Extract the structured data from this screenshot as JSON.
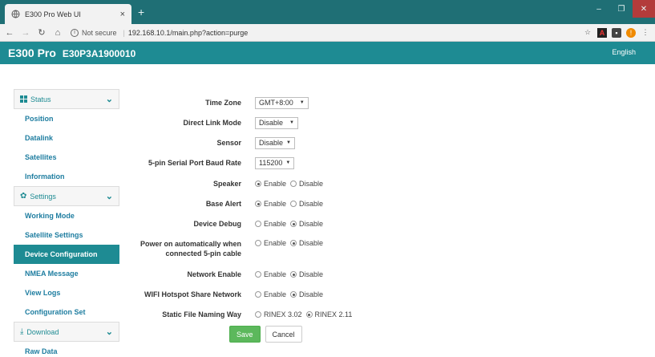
{
  "browser": {
    "tab_title": "E300 Pro Web UI",
    "tab_close": "×",
    "new_tab": "+",
    "not_secure": "Not secure",
    "url": "192.168.10.1/main.php?action=purge",
    "window_controls": [
      "–",
      "❐",
      "✕"
    ]
  },
  "header": {
    "brand": "E300 Pro",
    "serial": "E30P3A1900010",
    "language": "English"
  },
  "sidebar": {
    "status": {
      "label": "Status",
      "items": [
        "Position",
        "Datalink",
        "Satellites",
        "Information"
      ]
    },
    "settings": {
      "label": "Settings",
      "items": [
        "Working Mode",
        "Satellite Settings",
        "Device Configuration",
        "NMEA Message",
        "View Logs",
        "Configuration Set"
      ],
      "active": "Device Configuration"
    },
    "download": {
      "label": "Download",
      "items": [
        "Raw Data"
      ]
    }
  },
  "form": {
    "time_zone": {
      "label": "Time Zone",
      "value": "GMT+8:00"
    },
    "direct_link_mode": {
      "label": "Direct Link Mode",
      "value": "Disable"
    },
    "sensor": {
      "label": "Sensor",
      "value": "Disable"
    },
    "baud_rate": {
      "label": "5-pin Serial Port Baud Rate",
      "value": "115200"
    },
    "speaker": {
      "label": "Speaker",
      "opt1": "Enable",
      "opt2": "Disable",
      "selected": "Enable"
    },
    "base_alert": {
      "label": "Base Alert",
      "opt1": "Enable",
      "opt2": "Disable",
      "selected": "Enable"
    },
    "device_debug": {
      "label": "Device Debug",
      "opt1": "Enable",
      "opt2": "Disable",
      "selected": "Disable"
    },
    "power_on": {
      "label_line1": "Power on automatically when",
      "label_line2": "connected 5-pin cable",
      "opt1": "Enable",
      "opt2": "Disable",
      "selected": "Disable"
    },
    "network_enable": {
      "label": "Network Enable",
      "opt1": "Enable",
      "opt2": "Disable",
      "selected": "Disable"
    },
    "wifi_hotspot": {
      "label": "WIFI Hotspot Share Network",
      "opt1": "Enable",
      "opt2": "Disable",
      "selected": "Disable"
    },
    "file_naming": {
      "label": "Static File Naming Way",
      "opt1": "RINEX 3.02",
      "opt2": "RINEX 2.11",
      "selected": "RINEX 2.11"
    },
    "save_label": "Save",
    "cancel_label": "Cancel"
  },
  "colors": {
    "accent": "#1e8b93",
    "link": "#1e7da0",
    "save": "#5cb85c"
  }
}
